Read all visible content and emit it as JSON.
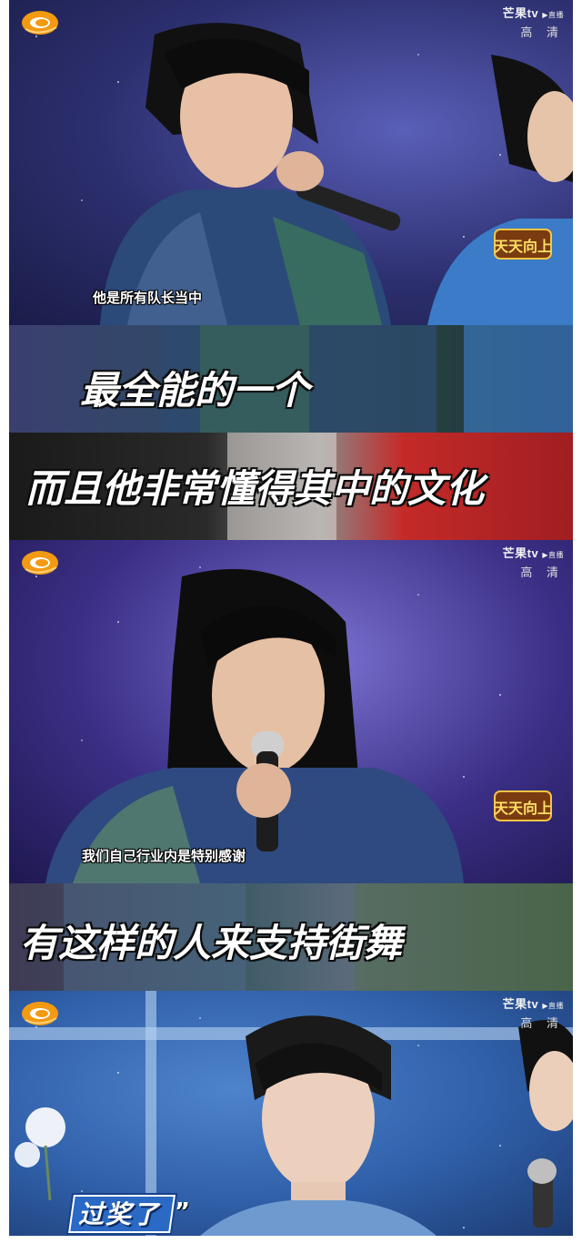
{
  "watermark": {
    "brand": "芒果tv",
    "live_tag": "▶直播",
    "quality": "高 清"
  },
  "panels": [
    {
      "caption": "他是所有队长当中"
    },
    {
      "caption": "最全能的一个"
    },
    {
      "caption": "而且他非常懂得其中的文化"
    },
    {
      "caption": "我们自己行业内是特别感谢"
    },
    {
      "caption": "有这样的人来支持街舞"
    },
    {
      "caption": "过奖了",
      "quote": "”"
    }
  ],
  "colors": {
    "panel1_bg": "#2c2f6e",
    "panel4_bg": "#3b2f86",
    "panel6_bg": "#2f5fa8",
    "logo_orange": "#f29a12"
  }
}
